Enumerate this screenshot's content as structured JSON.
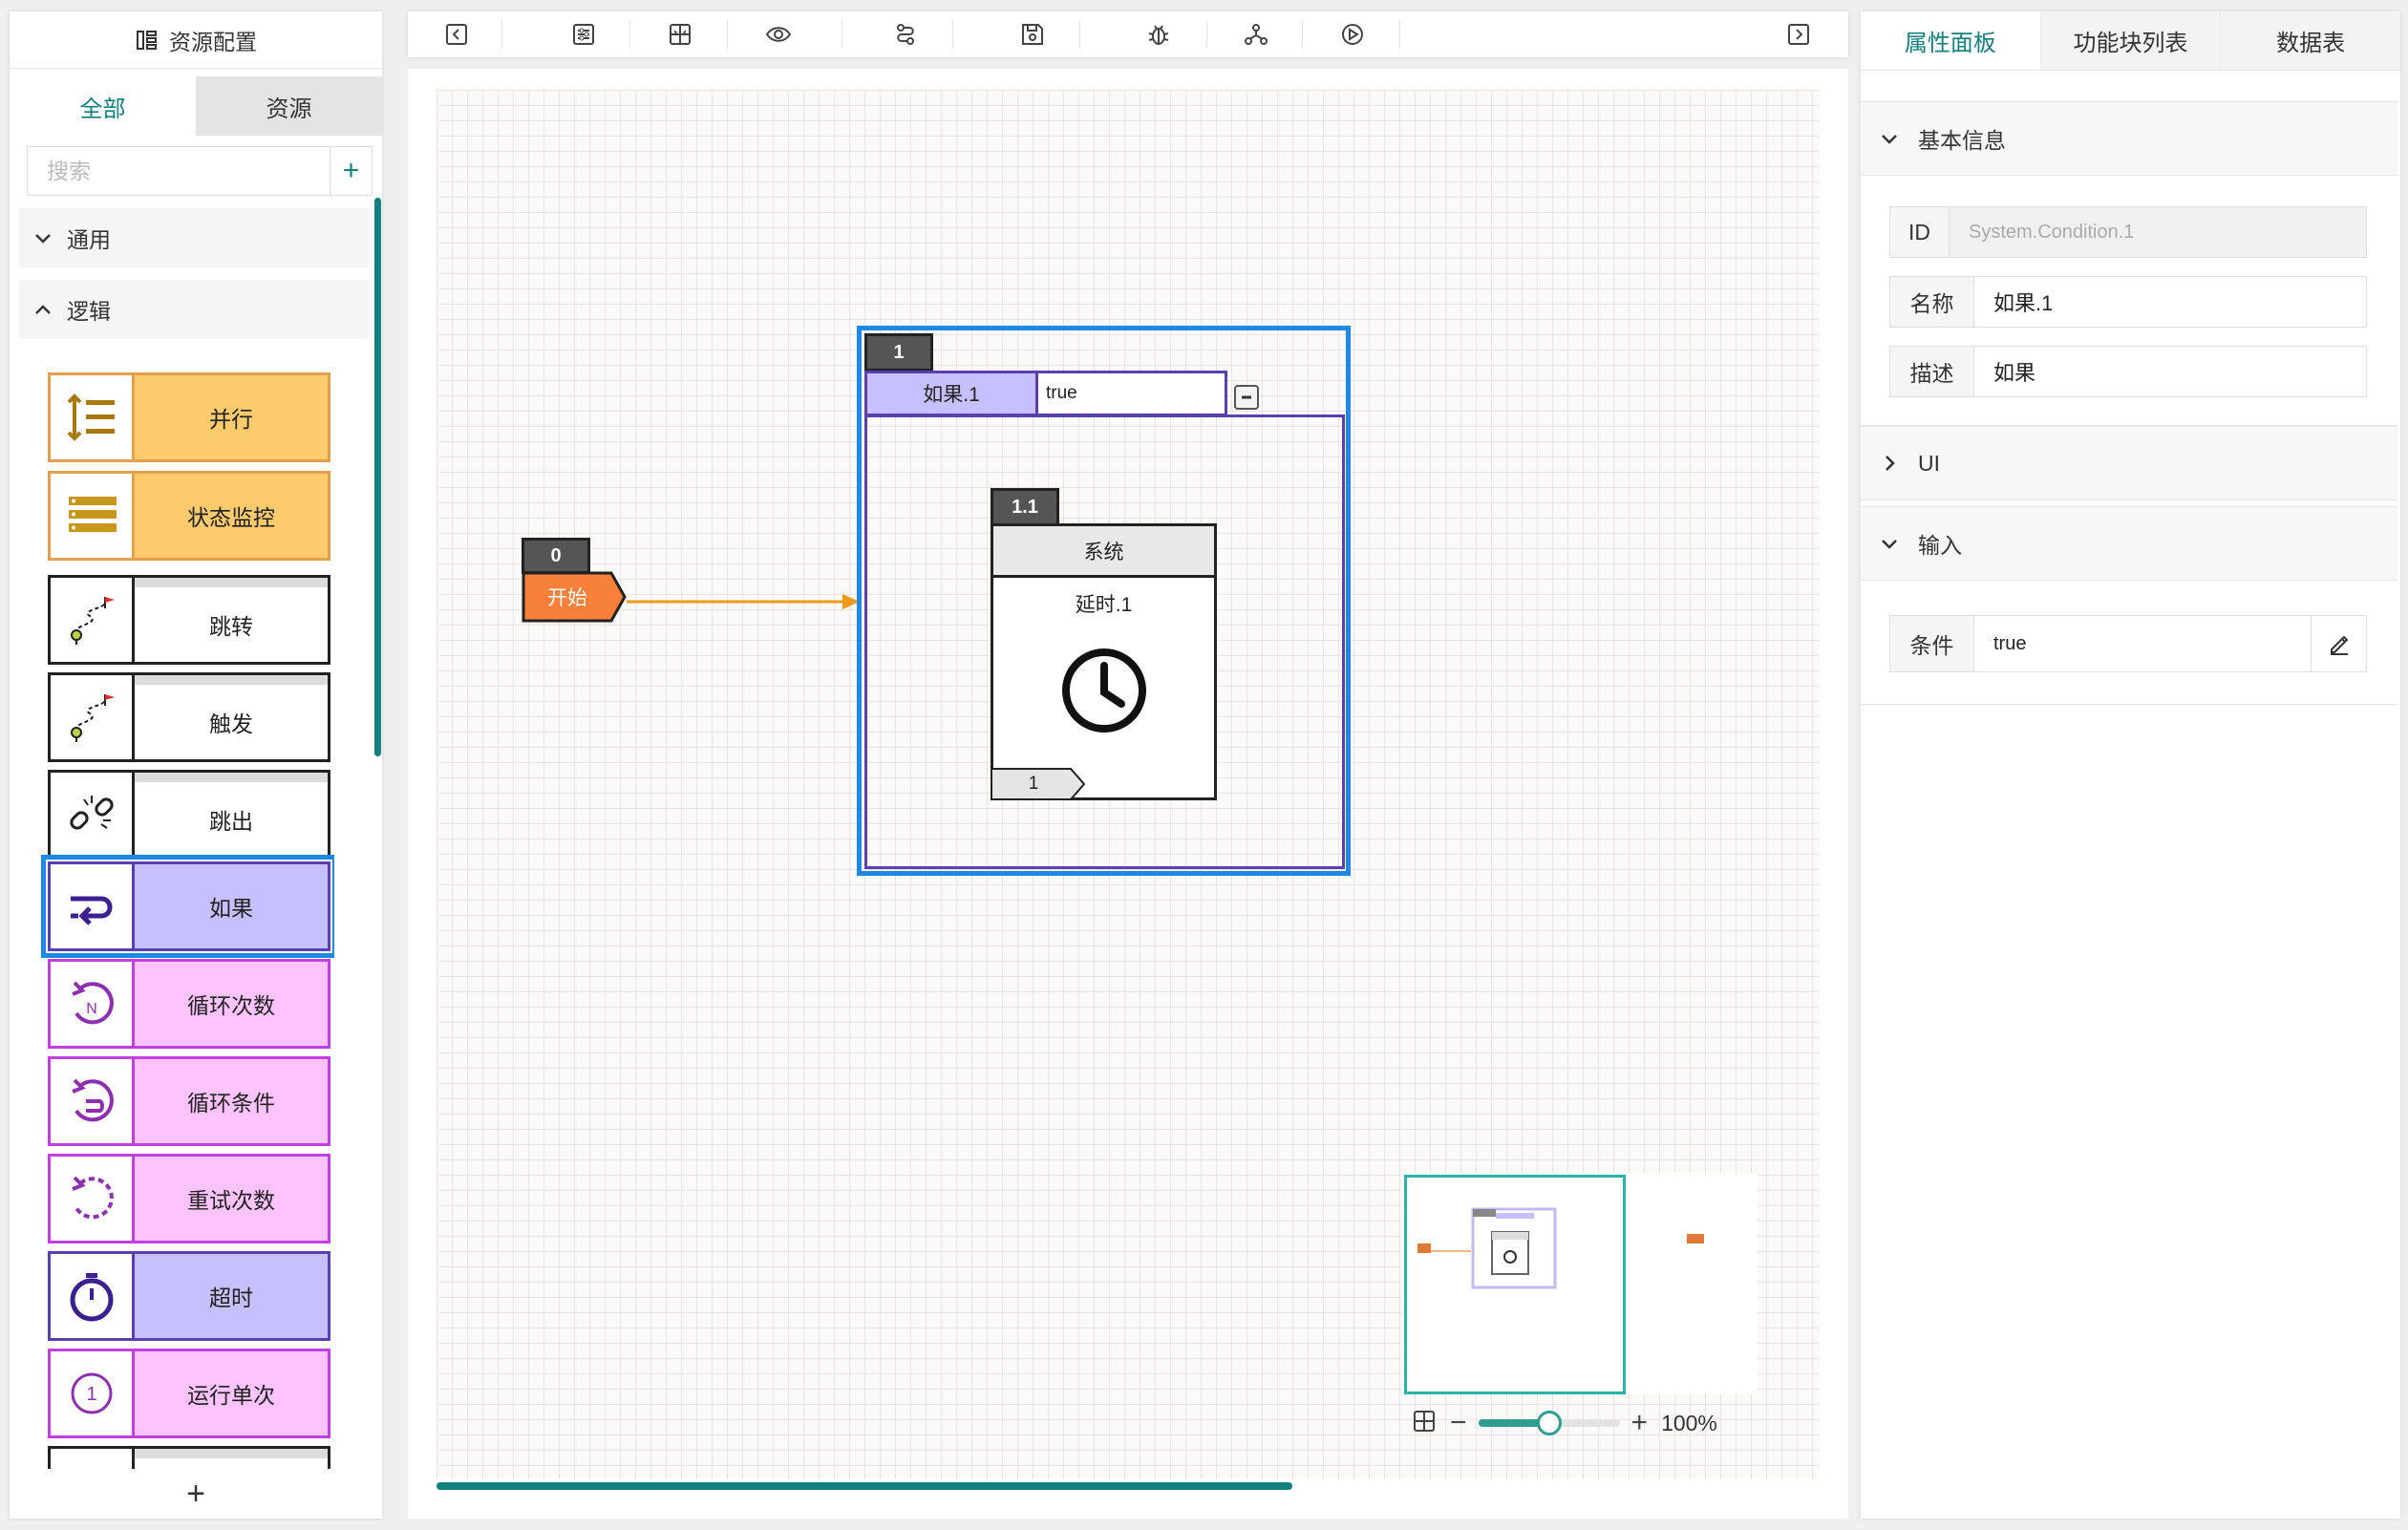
{
  "left_panel": {
    "title": "资源配置",
    "tabs": [
      "全部",
      "资源"
    ],
    "search_placeholder": "搜索",
    "add_symbol": "+",
    "categories": [
      {
        "label": "通用",
        "expanded": false
      },
      {
        "label": "逻辑",
        "expanded": true
      }
    ],
    "blocks": [
      {
        "label": "并行",
        "style": "yellow",
        "icon": "parallel-icon"
      },
      {
        "label": "状态监控",
        "style": "yellow",
        "icon": "list-monitor-icon"
      },
      {
        "label": "跳转",
        "style": "white",
        "icon": "route-flag-icon"
      },
      {
        "label": "触发",
        "style": "white",
        "icon": "route-flag-icon"
      },
      {
        "label": "跳出",
        "style": "white",
        "icon": "broken-chain-icon"
      },
      {
        "label": "如果",
        "style": "purple",
        "icon": "if-return-icon",
        "selected": true
      },
      {
        "label": "循环次数",
        "style": "pink",
        "icon": "loop-count-icon"
      },
      {
        "label": "循环条件",
        "style": "pink",
        "icon": "loop-condition-icon"
      },
      {
        "label": "重试次数",
        "style": "pink",
        "icon": "retry-icon"
      },
      {
        "label": "超时",
        "style": "purple",
        "icon": "stopwatch-icon"
      },
      {
        "label": "运行单次",
        "style": "pink",
        "icon": "run-once-icon"
      }
    ],
    "footer_symbol": "+"
  },
  "toolbar": {
    "buttons": [
      "collapse-left-icon",
      "settings-sliders-icon",
      "fit-view-icon",
      "eye-icon",
      "route-icon",
      "save-icon",
      "debug-bug-icon",
      "network-icon",
      "play-icon",
      "collapse-right-icon"
    ]
  },
  "canvas": {
    "start_node": {
      "number": "0",
      "label": "开始"
    },
    "if_node": {
      "number": "1",
      "name": "如果.1",
      "condition": "true"
    },
    "delay_node": {
      "number": "1.1",
      "category": "系统",
      "title": "延时.1",
      "port": "1"
    },
    "zoom": {
      "level": "100%",
      "fraction": 0.5
    }
  },
  "right_panel": {
    "tabs": [
      "属性面板",
      "功能块列表",
      "数据表"
    ],
    "active_tab": 0,
    "sections": {
      "basic": {
        "title": "基本信息",
        "expanded": true
      },
      "ui": {
        "title": "UI",
        "expanded": false
      },
      "input": {
        "title": "输入",
        "expanded": true
      }
    },
    "fields": {
      "id_label": "ID",
      "id_value": "System.Condition.1",
      "name_label": "名称",
      "name_value": "如果.1",
      "desc_label": "描述",
      "desc_value": "如果",
      "cond_label": "条件",
      "cond_value": "true"
    }
  },
  "colors": {
    "accent": "#12807d",
    "selection": "#1e88e5",
    "start": "#f7803a",
    "if_header": "#c6c0ff"
  }
}
